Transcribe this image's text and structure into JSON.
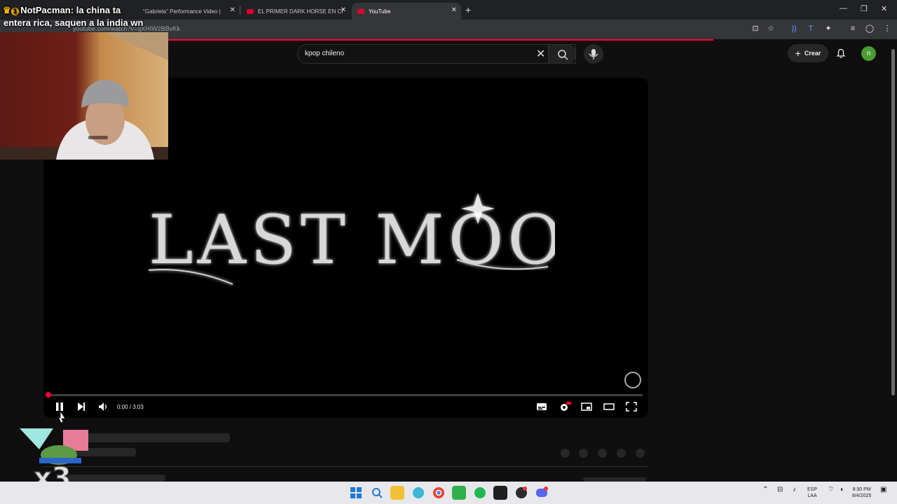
{
  "browser": {
    "tabs": [
      {
        "label": "\"Gabriela\" Performance Video |"
      },
      {
        "label": "EL PRIMER DARK HORSE EN CI"
      },
      {
        "label": "YouTube"
      }
    ],
    "url": "youtube.com/watch?v=qXHIW2BBvKk"
  },
  "chat_overlay": {
    "badge": "1",
    "username": "NotPacman:",
    "message_part1": "la china ta",
    "message_part2": "entera rica, saquen a la india wn"
  },
  "youtube": {
    "search_value": "kpop chileno",
    "create_label": "Crear",
    "avatar_letter": "n"
  },
  "player": {
    "logo_text": "LAST MOON",
    "time": "0:00 / 3:03",
    "progress_fraction": 0.0
  },
  "sticker": {
    "multiplier": "x3"
  },
  "taskbar": {
    "lang_top": "ESP",
    "lang_bottom": "LAA",
    "clock_time": "8:30 PM",
    "clock_date": "8/4/2025"
  },
  "colors": {
    "accent": "#ff0033",
    "background": "#0f0f0f"
  }
}
